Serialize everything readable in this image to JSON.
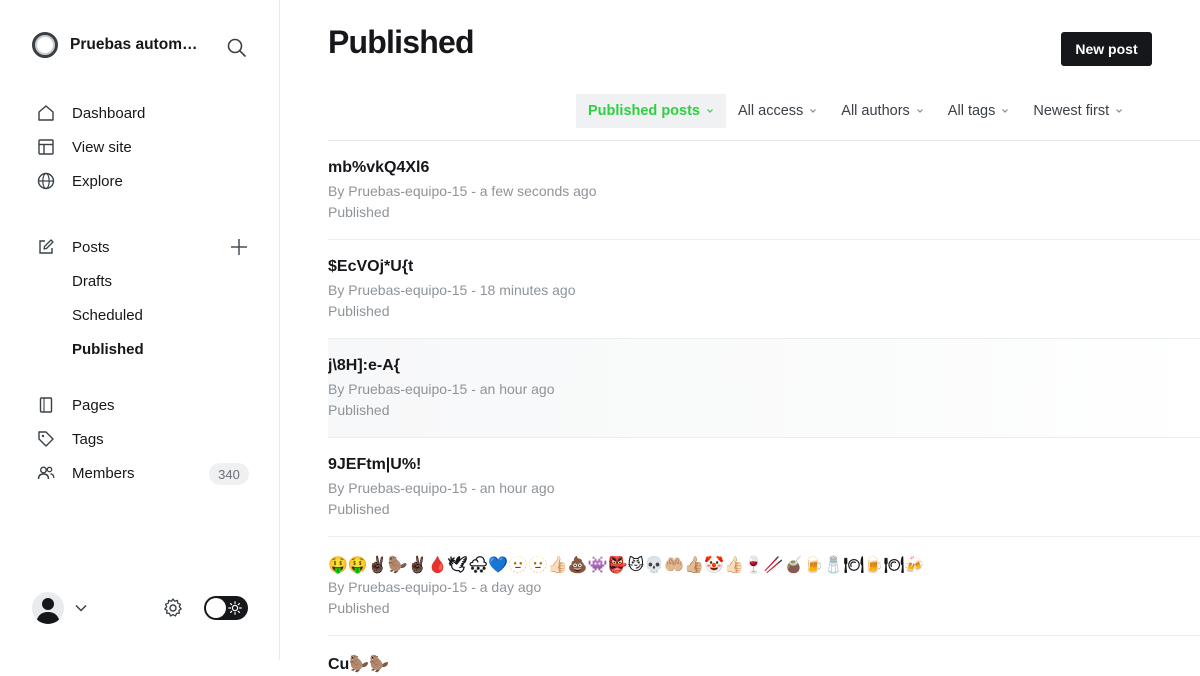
{
  "sidebar": {
    "brand_name": "Pruebas automatizadas",
    "nav_main": [
      {
        "label": "Dashboard",
        "icon": "home-icon"
      },
      {
        "label": "View site",
        "icon": "layout-icon"
      },
      {
        "label": "Explore",
        "icon": "globe-icon"
      }
    ],
    "posts": {
      "label": "Posts",
      "icon": "pencil-edit-icon"
    },
    "posts_sub": [
      {
        "label": "Drafts"
      },
      {
        "label": "Scheduled"
      },
      {
        "label": "Published",
        "active": true
      }
    ],
    "nav_lower": [
      {
        "label": "Pages",
        "icon": "page-icon"
      },
      {
        "label": "Tags",
        "icon": "tag-icon"
      },
      {
        "label": "Members",
        "icon": "members-icon",
        "count": "340"
      }
    ]
  },
  "main": {
    "title": "Published",
    "new_post_label": "New post",
    "filters": [
      {
        "label": "Published posts",
        "active": true
      },
      {
        "label": "All access"
      },
      {
        "label": "All authors"
      },
      {
        "label": "All tags"
      },
      {
        "label": "Newest first"
      }
    ],
    "posts": [
      {
        "title": "mb%vkQ4Xl6",
        "meta": "By Pruebas-equipo-15 - a few seconds ago",
        "status": "Published"
      },
      {
        "title": "$EcVOj*U{t",
        "meta": "By Pruebas-equipo-15 - 18 minutes ago",
        "status": "Published"
      },
      {
        "title": "j\\8H]:e-A{",
        "meta": "By Pruebas-equipo-15 - an hour ago",
        "status": "Published",
        "hover": true
      },
      {
        "title": "9JEFtm|U%!",
        "meta": "By Pruebas-equipo-15 - an hour ago",
        "status": "Published"
      },
      {
        "title": "🤑🤑✌🏿🦫✌🏿🩸🕊🌨💙🫥🫥👍🏻💩👾👺😼💀🤲🏼👍🏼🤡👍🏻🍷🥢🧉🍺🧂🍽🍺🍽🍻",
        "meta": "By Pruebas-equipo-15 - a day ago",
        "status": "Published",
        "emoji_title": true
      }
    ],
    "partial_post_title": "Cu🦫🦫"
  },
  "colors": {
    "accent_green": "#30cf43",
    "ink": "#15171a",
    "muted": "#8e9499"
  }
}
